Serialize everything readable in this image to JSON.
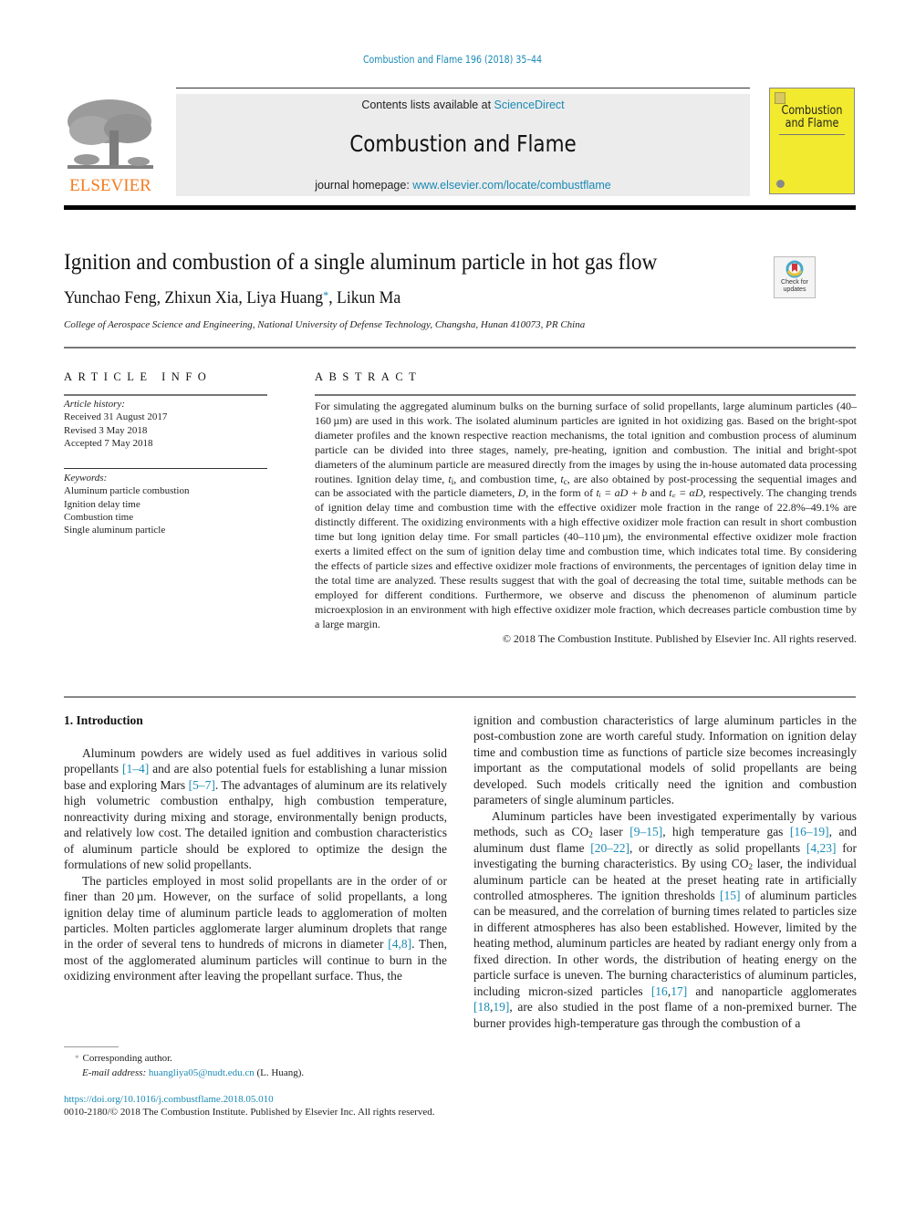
{
  "header": {
    "running_head": "Combustion and Flame 196 (2018) 35–44",
    "publisher_wordmark": "ELSEVIER",
    "contents_prefix": "Contents lists available at ",
    "contents_link": "ScienceDirect",
    "journal_name": "Combustion and Flame",
    "homepage_prefix": "journal homepage: ",
    "homepage_link": "www.elsevier.com/locate/combustflame",
    "cover_title_line1": "Combustion",
    "cover_title_line2": "and Flame",
    "brand_color": "#1a8ab5",
    "elsevier_color": "#f47b20",
    "cover_color": "#f2ea2e"
  },
  "article": {
    "title": "Ignition and combustion of a single aluminum particle in hot gas flow",
    "authors_before_star": "Yunchao Feng, Zhixun Xia, Liya Huang",
    "corresponding_mark": "*",
    "authors_after_star": ", Likun Ma",
    "affiliation": "College of Aerospace Science and Engineering, National University of Defense Technology, Changsha, Hunan 410073, PR China",
    "check_updates_line1": "Check for",
    "check_updates_line2": "updates"
  },
  "article_info": {
    "heading": "ARTICLE INFO",
    "history_label": "Article history:",
    "history": [
      "Received 31 August 2017",
      "Revised 3 May 2018",
      "Accepted 7 May 2018"
    ],
    "keywords_label": "Keywords:",
    "keywords": [
      "Aluminum particle combustion",
      "Ignition delay time",
      "Combustion time",
      "Single aluminum particle"
    ]
  },
  "abstract": {
    "heading": "ABSTRACT",
    "text_1": "For simulating the aggregated aluminum bulks on the burning surface of solid propellants, large aluminum particles (40–160 µm) are used in this work. The isolated aluminum particles are ignited in hot oxidizing gas. Based on the bright-spot diameter profiles and the known respective reaction mechanisms, the total ignition and combustion process of aluminum particle can be divided into three stages, namely, pre-heating, ignition and combustion. The initial and bright-spot diameters of the aluminum particle are measured directly from the images by using the in-house automated data processing routines. Ignition delay time, ",
    "ti": "t",
    "ti_sub": "i",
    "text_2": ", and combustion time, ",
    "tc": "t",
    "tc_sub": "c",
    "text_3": ", are also obtained by post-processing the sequential images and can be associated with the particle diameters, ",
    "D": "D",
    "text_4": ", in the form of ",
    "eq1": "tᵢ = aD + b",
    "text_5": " and ",
    "eq2": "t꜀ = αD",
    "text_6": ", respectively. The changing trends of ignition delay time and combustion time with the effective oxidizer mole fraction in the range of 22.8%–49.1% are distinctly different. The oxidizing environments with a high effective oxidizer mole fraction can result in short combustion time but long ignition delay time. For small particles (40–110 µm), the environmental effective oxidizer mole fraction exerts a limited effect on the sum of ignition delay time and combustion time, which indicates total time. By considering the effects of particle sizes and effective oxidizer mole fractions of environments, the percentages of ignition delay time in the total time are analyzed. These results suggest that with the goal of decreasing the total time, suitable methods can be employed for different conditions. Furthermore, we observe and discuss the phenomenon of aluminum particle microexplosion in an environment with high effective oxidizer mole fraction, which decreases particle combustion time by a large margin.",
    "copyright": "© 2018 The Combustion Institute. Published by Elsevier Inc. All rights reserved."
  },
  "body": {
    "section_title": "1.  Introduction",
    "p1_a": "Aluminum powders are widely used as fuel additives in various solid propellants ",
    "p1_ref1": "[1–4]",
    "p1_b": " and are also potential fuels for establishing a lunar mission base and exploring Mars ",
    "p1_ref2": "[5–7]",
    "p1_c": ". The advantages of aluminum are its relatively high volumetric combustion enthalpy, high combustion temperature, nonreactivity during mixing and storage, environmentally benign products, and relatively low cost. The detailed ignition and combustion characteristics of aluminum particle should be explored to optimize the design the formulations of new solid propellants.",
    "p2_a": "The particles employed in most solid propellants are in the order of or finer than 20 µm. However, on the surface of solid propellants, a long ignition delay time of aluminum particle leads to agglomeration of molten particles. Molten particles agglomerate larger aluminum droplets that range in the order of several tens to hundreds of microns in diameter ",
    "p2_ref": "[4,8]",
    "p2_b": ". Then, most of the agglomerated aluminum particles will continue to burn in the oxidizing environment after leaving the propellant surface. Thus, the",
    "c2_p1": "ignition and combustion characteristics of large aluminum particles in the post-combustion zone are worth careful study. Information on ignition delay time and combustion time as functions of particle size becomes increasingly important as the computational models of solid propellants are being developed. Such models critically need the ignition and combustion parameters of single aluminum particles.",
    "c2_p2_a": "Aluminum particles have been investigated experimentally by various methods, such as CO",
    "c2_sub2": "2",
    "c2_p2_b": " laser ",
    "c2_ref1": "[9–15]",
    "c2_p2_c": ", high temperature gas ",
    "c2_ref2": "[16–19]",
    "c2_p2_d": ", and aluminum dust flame ",
    "c2_ref3": "[20–22]",
    "c2_p2_e": ", or directly as solid propellants ",
    "c2_ref4": "[4,23]",
    "c2_p2_f": " for investigating the burning characteristics. By using CO",
    "c2_p2_g": " laser, the individual aluminum particle can be heated at the preset heating rate in artificially controlled atmospheres. The ignition thresholds ",
    "c2_ref5": "[15]",
    "c2_p2_h": " of aluminum particles can be measured, and the correlation of burning times related to particles size in different atmospheres has also been established. However, limited by the heating method, aluminum particles are heated by radiant energy only from a fixed direction. In other words, the distribution of heating energy on the particle surface is uneven. The burning characteristics of aluminum particles, including micron-sized particles ",
    "c2_ref6a": "[16",
    "c2_ref6b": "17]",
    "c2_p2_i": " and nanoparticle agglomerates ",
    "c2_ref7a": "[18",
    "c2_ref7b": "19]",
    "c2_p2_j": ", are also studied in the post flame of a non-premixed burner. The burner provides high-temperature gas through the combustion of a"
  },
  "footer": {
    "footnote_mark": "*",
    "corresponding": "Corresponding author.",
    "email_label": "E-mail address: ",
    "email": "huangliya05@nudt.edu.cn",
    "email_suffix": " (L. Huang).",
    "doi": "https://doi.org/10.1016/j.combustflame.2018.05.010",
    "issn_line": "0010-2180/© 2018 The Combustion Institute. Published by Elsevier Inc. All rights reserved."
  }
}
